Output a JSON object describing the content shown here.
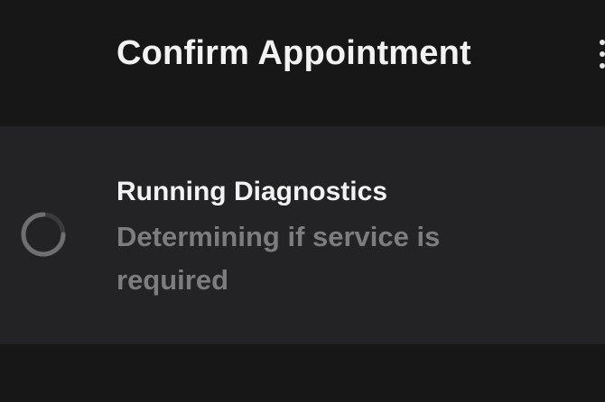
{
  "header": {
    "title": "Confirm Appointment",
    "menu_icon": "more-vertical-icon"
  },
  "status_card": {
    "icon": "loading-spinner-icon",
    "title": "Running Diagnostics",
    "detail": "Determining if service is required"
  },
  "colors": {
    "background": "#171717",
    "card_background": "#232325",
    "primary_text": "#f2f2f2",
    "secondary_text": "#7d7d80"
  }
}
